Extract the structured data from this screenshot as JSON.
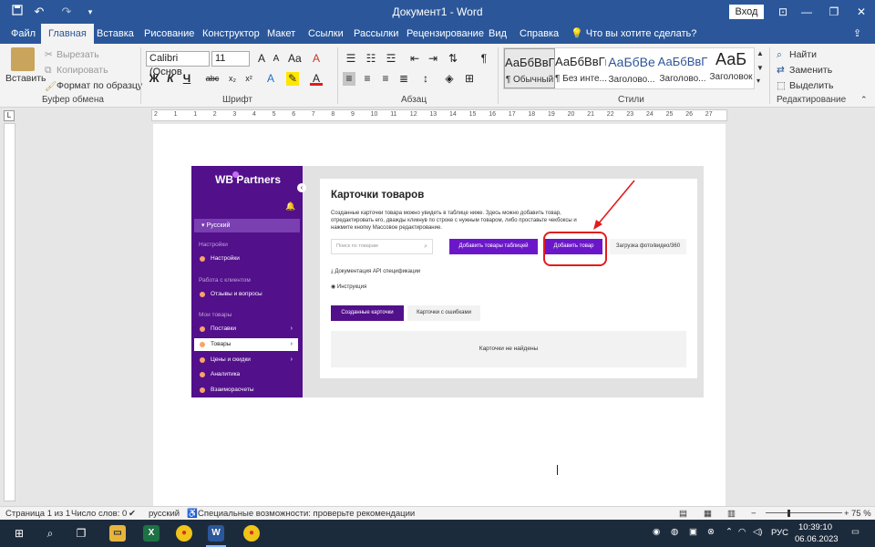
{
  "title_bar": {
    "document_title": "Документ1  -  Word",
    "sign_in": "Вход",
    "minimize": "—",
    "restore": "❐",
    "close": "✕",
    "save_icon": "save-icon",
    "undo_icon": "undo-icon",
    "redo_icon": "redo-icon"
  },
  "ribbon_tabs": [
    "Файл",
    "Главная",
    "Вставка",
    "Рисование",
    "Конструктор",
    "Макет",
    "Ссылки",
    "Рассылки",
    "Рецензирование",
    "Вид",
    "Справка"
  ],
  "tell_me": "Что вы хотите сделать?",
  "clipboard": {
    "paste": "Вставить",
    "cut": "Вырезать",
    "copy": "Копировать",
    "format_painter": "Формат по образцу",
    "label": "Буфер обмена"
  },
  "font": {
    "name": "Calibri (Основ",
    "size": "11",
    "bold": "Ж",
    "italic": "К",
    "underline": "Ч",
    "strike": "abc",
    "label": "Шрифт"
  },
  "paragraph": {
    "label": "Абзац"
  },
  "styles": {
    "label": "Стили",
    "items": [
      {
        "preview": "АаБбВвГг,",
        "name": "¶ Обычный"
      },
      {
        "preview": "АаБбВвГг,",
        "name": "¶ Без инте..."
      },
      {
        "preview": "АаБбВе",
        "name": "Заголово..."
      },
      {
        "preview": "АаБбВвГ",
        "name": "Заголово..."
      },
      {
        "preview": "АаБ",
        "name": "Заголовок"
      }
    ]
  },
  "editing": {
    "find": "Найти",
    "replace": "Заменить",
    "select": "Выделить",
    "label": "Редактирование"
  },
  "ruler": [
    "2",
    "1",
    "1",
    "2",
    "3",
    "4",
    "5",
    "6",
    "7",
    "8",
    "9",
    "10",
    "11",
    "12",
    "13",
    "14",
    "15",
    "16",
    "17",
    "18",
    "19",
    "20",
    "21",
    "22",
    "23",
    "24",
    "25",
    "26",
    "27"
  ],
  "wb": {
    "logo": "WB Partners",
    "lang": "Русский",
    "sidebar": {
      "settings_header": "Настройки",
      "settings": "Настройки",
      "clients_header": "Работа с клиентом",
      "reviews": "Отзывы и вопросы",
      "goods_header": "Мои товары",
      "supplies": "Поставки",
      "goods": "Товары",
      "prices": "Цены и скидки",
      "analytics": "Аналитика",
      "settlements": "Взаиморасчеты"
    },
    "title": "Карточки товаров",
    "description": "Созданные карточки товара можно увидеть в таблице ниже. Здесь можно добавить товар, отредактировать его, дважды кликнув по строке с нужным товаром, либо проставьте чекбоксы и нажмите кнопку Массовое редактирование.",
    "search_placeholder": "Поиск по товарам",
    "add_table_button": "Добавить товары таблицей",
    "add_good_button": "Добавить товар",
    "upload_media": "Загрузка фото/видео/360",
    "api_docs": "Документация API спецификации",
    "instruction": "Инструкция",
    "tab_created": "Созданные карточки",
    "tab_errors": "Карточки с ошибками",
    "empty": "Карточки не найдены",
    "accent_color": "#6b17c9",
    "sidebar_color": "#52108b"
  },
  "status": {
    "page": "Страница 1 из 1",
    "words": "Число слов: 0",
    "lang": "русский",
    "accessibility": "Специальные возможности: проверьте рекомендации",
    "zoom": "75 %"
  },
  "taskbar": {
    "lang": "РУС",
    "time": "10:39:10",
    "date": "06.06.2023"
  }
}
